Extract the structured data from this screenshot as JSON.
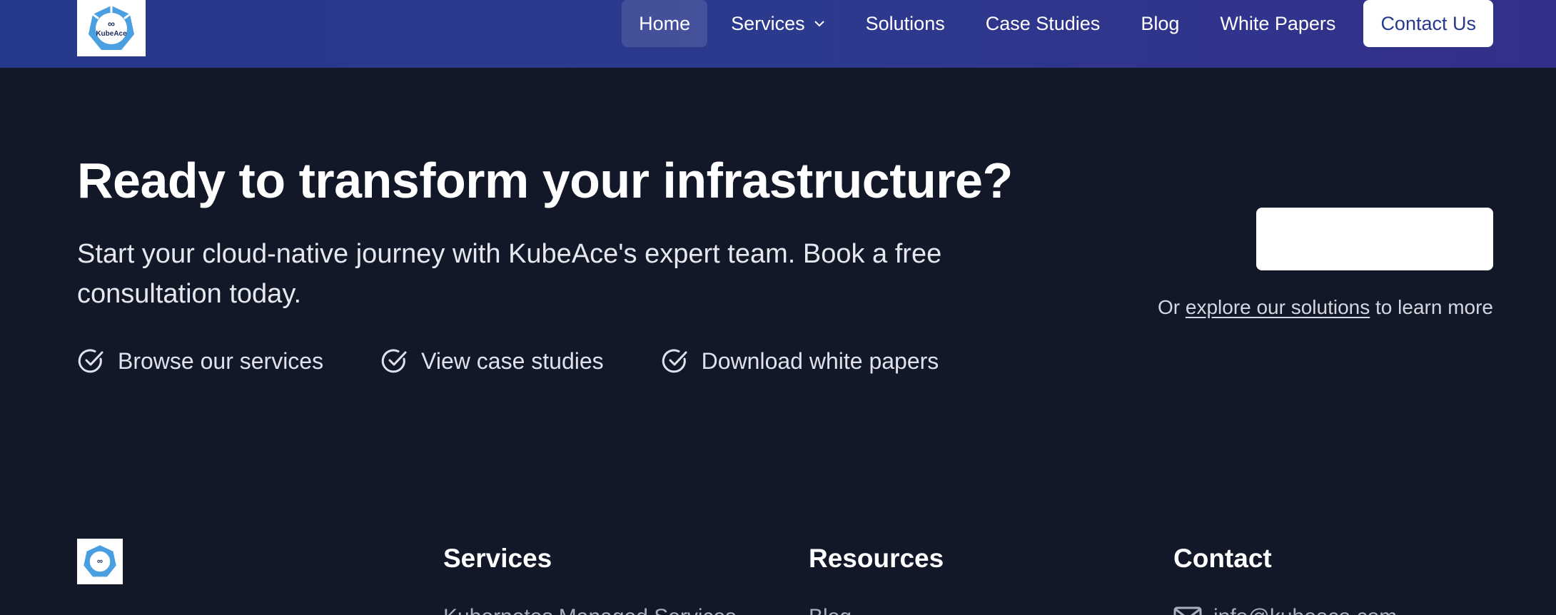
{
  "nav": {
    "logo_text": "KubeAce",
    "items": [
      {
        "label": "Home",
        "active": true
      },
      {
        "label": "Services",
        "has_dropdown": true
      },
      {
        "label": "Solutions"
      },
      {
        "label": "Case Studies"
      },
      {
        "label": "Blog"
      },
      {
        "label": "White Papers"
      }
    ],
    "contact_label": "Contact Us"
  },
  "hero": {
    "title": "Ready to transform your infrastructure?",
    "subtitle": "Start your cloud-native journey with KubeAce's expert team. Book a free consultation today.",
    "checks": [
      "Browse our services",
      "View case studies",
      "Download white papers"
    ],
    "explore_prefix": "Or ",
    "explore_link": "explore our solutions",
    "explore_suffix": " to learn more"
  },
  "footer": {
    "columns": [
      {
        "heading": "Services",
        "first_item": "Kubernetes Managed Services"
      },
      {
        "heading": "Resources",
        "first_item": "Blog"
      },
      {
        "heading": "Contact",
        "first_item": "info@kubeace.com"
      }
    ]
  },
  "colors": {
    "nav_start": "#26388a",
    "nav_end": "#33308a",
    "page_bg": "#131828",
    "accent": "#27398c",
    "logo_blue": "#4a9fe0"
  },
  "icons": {
    "check": "check-circle-icon",
    "chevron": "chevron-down-icon",
    "mail": "mail-icon",
    "logo": "kubeace-logo-icon"
  }
}
